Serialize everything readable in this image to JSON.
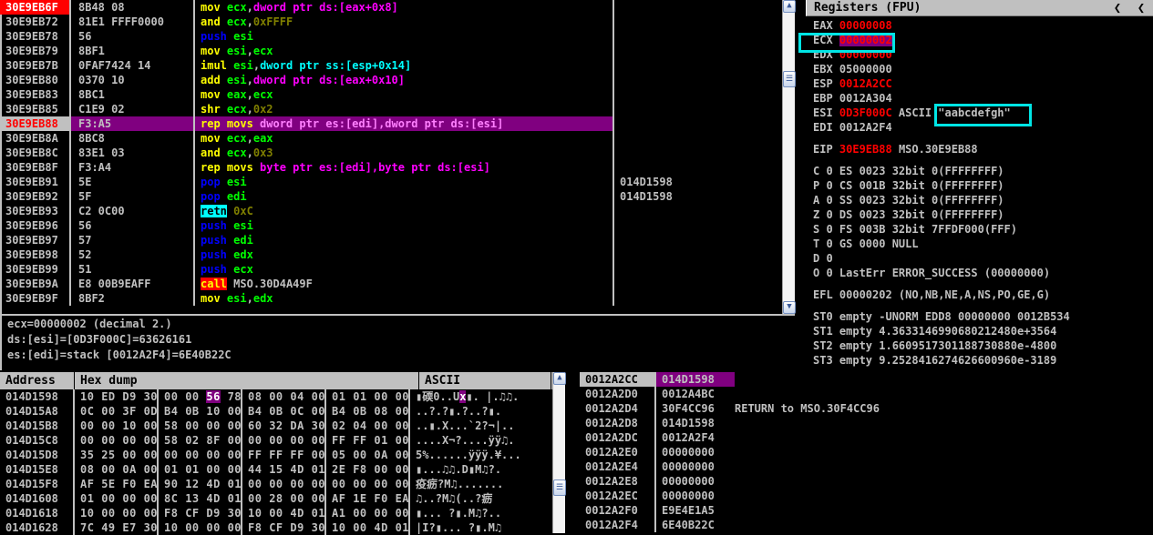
{
  "registers_panel": {
    "title": "Registers (FPU)",
    "nav_back_icon": "chevron-left-icon",
    "nav_back2_icon": "chevron-left-icon",
    "general": [
      {
        "name": "EAX",
        "value": "00000008",
        "value_color": "#ff0000",
        "extra": ""
      },
      {
        "name": "ECX",
        "value": "00000002",
        "value_color": "#ff0000",
        "extra": "",
        "highlighted": true
      },
      {
        "name": "EDX",
        "value": "00000000",
        "value_color": "#ff0000",
        "extra": ""
      },
      {
        "name": "EBX",
        "value": "05000000",
        "value_color": "#c0c0c0",
        "extra": ""
      },
      {
        "name": "ESP",
        "value": "0012A2CC",
        "value_color": "#ff0000",
        "extra": ""
      },
      {
        "name": "EBP",
        "value": "0012A304",
        "value_color": "#c0c0c0",
        "extra": ""
      },
      {
        "name": "ESI",
        "value": "0D3F000C",
        "value_color": "#ff0000",
        "extra": "ASCII",
        "ascii": "\"aabcdefgh\""
      },
      {
        "name": "EDI",
        "value": "0012A2F4",
        "value_color": "#c0c0c0",
        "extra": ""
      }
    ],
    "eip": {
      "name": "EIP",
      "value": "30E9EB88",
      "symbol": "MSO.30E9EB88"
    },
    "flags": [
      {
        "flag": "C",
        "val": "0",
        "seg": "ES",
        "sel": "0023",
        "mode": "32bit",
        "base": "0(FFFFFFFF)"
      },
      {
        "flag": "P",
        "val": "0",
        "seg": "CS",
        "sel": "001B",
        "mode": "32bit",
        "base": "0(FFFFFFFF)"
      },
      {
        "flag": "A",
        "val": "0",
        "seg": "SS",
        "sel": "0023",
        "mode": "32bit",
        "base": "0(FFFFFFFF)"
      },
      {
        "flag": "Z",
        "val": "0",
        "seg": "DS",
        "sel": "0023",
        "mode": "32bit",
        "base": "0(FFFFFFFF)"
      },
      {
        "flag": "S",
        "val": "0",
        "seg": "FS",
        "sel": "003B",
        "mode": "32bit",
        "base": "7FFDF000(FFF)"
      },
      {
        "flag": "T",
        "val": "0",
        "seg": "GS",
        "sel": "0000",
        "mode": "NULL",
        "base": ""
      },
      {
        "flag": "D",
        "val": "0",
        "seg": "",
        "sel": "",
        "mode": "",
        "base": ""
      },
      {
        "flag": "O",
        "val": "0",
        "seg": "",
        "sel": "",
        "mode": "",
        "base": "",
        "lasterr": "LastErr ERROR_SUCCESS (00000000)"
      }
    ],
    "efl": {
      "name": "EFL",
      "value": "00000202",
      "decoded": "(NO,NB,NE,A,NS,PO,GE,G)"
    },
    "fpu": [
      {
        "name": "ST0",
        "state": "empty",
        "value": "-UNORM EDD8 00000000 0012B534"
      },
      {
        "name": "ST1",
        "state": "empty",
        "value": "4.3633146990680212480e+3564"
      },
      {
        "name": "ST2",
        "state": "empty",
        "value": "1.6609517301188730880e-4800"
      },
      {
        "name": "ST3",
        "state": "empty",
        "value": "9.2528416274626600960e-3189"
      }
    ]
  },
  "disassembly": {
    "rows": [
      {
        "addr": "30E9EB6F",
        "bytes": "8B48 08",
        "text": [
          {
            "t": "mov",
            "c": "mn"
          },
          {
            "t": " ",
            "c": "plain"
          },
          {
            "t": "ecx",
            "c": "reg"
          },
          {
            "t": ",",
            "c": "plain"
          },
          {
            "t": "dword ptr ds:[eax+0x8]",
            "c": "memds"
          }
        ],
        "comment": "",
        "state": "eip"
      },
      {
        "addr": "30E9EB72",
        "bytes": "81E1 FFFF0000",
        "text": [
          {
            "t": "and",
            "c": "mn"
          },
          {
            "t": " ",
            "c": "plain"
          },
          {
            "t": "ecx",
            "c": "reg"
          },
          {
            "t": ",",
            "c": "plain"
          },
          {
            "t": "0xFFFF",
            "c": "num"
          }
        ],
        "comment": "",
        "state": ""
      },
      {
        "addr": "30E9EB78",
        "bytes": "56",
        "text": [
          {
            "t": "push",
            "c": "mn-push"
          },
          {
            "t": " ",
            "c": "plain"
          },
          {
            "t": "esi",
            "c": "reg"
          }
        ],
        "comment": "",
        "state": ""
      },
      {
        "addr": "30E9EB79",
        "bytes": "8BF1",
        "text": [
          {
            "t": "mov",
            "c": "mn"
          },
          {
            "t": " ",
            "c": "plain"
          },
          {
            "t": "esi",
            "c": "reg"
          },
          {
            "t": ",",
            "c": "plain"
          },
          {
            "t": "ecx",
            "c": "reg"
          }
        ],
        "comment": "",
        "state": ""
      },
      {
        "addr": "30E9EB7B",
        "bytes": "0FAF7424 14",
        "text": [
          {
            "t": "imul",
            "c": "mn"
          },
          {
            "t": " ",
            "c": "plain"
          },
          {
            "t": "esi",
            "c": "reg"
          },
          {
            "t": ",",
            "c": "plain"
          },
          {
            "t": "dword ptr ss:[esp+0x14]",
            "c": "memss"
          }
        ],
        "comment": "",
        "state": ""
      },
      {
        "addr": "30E9EB80",
        "bytes": "0370 10",
        "text": [
          {
            "t": "add",
            "c": "mn"
          },
          {
            "t": " ",
            "c": "plain"
          },
          {
            "t": "esi",
            "c": "reg"
          },
          {
            "t": ",",
            "c": "plain"
          },
          {
            "t": "dword ptr ds:[eax+0x10]",
            "c": "memds"
          }
        ],
        "comment": "",
        "state": ""
      },
      {
        "addr": "30E9EB83",
        "bytes": "8BC1",
        "text": [
          {
            "t": "mov",
            "c": "mn"
          },
          {
            "t": " ",
            "c": "plain"
          },
          {
            "t": "eax",
            "c": "reg"
          },
          {
            "t": ",",
            "c": "plain"
          },
          {
            "t": "ecx",
            "c": "reg"
          }
        ],
        "comment": "",
        "state": ""
      },
      {
        "addr": "30E9EB85",
        "bytes": "C1E9 02",
        "text": [
          {
            "t": "shr",
            "c": "mn"
          },
          {
            "t": " ",
            "c": "plain"
          },
          {
            "t": "ecx",
            "c": "reg"
          },
          {
            "t": ",",
            "c": "plain"
          },
          {
            "t": "0x2",
            "c": "num"
          }
        ],
        "comment": "",
        "state": ""
      },
      {
        "addr": "30E9EB88",
        "bytes": "F3:A5",
        "text": [
          {
            "t": "rep movs",
            "c": "mn"
          },
          {
            "t": " ",
            "c": "plain"
          },
          {
            "t": "dword ptr es:[edi],dword ptr ds:[esi]",
            "c": "op"
          }
        ],
        "comment": "",
        "state": "cur"
      },
      {
        "addr": "30E9EB8A",
        "bytes": "8BC8",
        "text": [
          {
            "t": "mov",
            "c": "mn"
          },
          {
            "t": " ",
            "c": "plain"
          },
          {
            "t": "ecx",
            "c": "reg"
          },
          {
            "t": ",",
            "c": "plain"
          },
          {
            "t": "eax",
            "c": "reg"
          }
        ],
        "comment": "",
        "state": ""
      },
      {
        "addr": "30E9EB8C",
        "bytes": "83E1 03",
        "text": [
          {
            "t": "and",
            "c": "mn"
          },
          {
            "t": " ",
            "c": "plain"
          },
          {
            "t": "ecx",
            "c": "reg"
          },
          {
            "t": ",",
            "c": "plain"
          },
          {
            "t": "0x3",
            "c": "num"
          }
        ],
        "comment": "",
        "state": ""
      },
      {
        "addr": "30E9EB8F",
        "bytes": "F3:A4",
        "text": [
          {
            "t": "rep movs",
            "c": "mn"
          },
          {
            "t": " ",
            "c": "plain"
          },
          {
            "t": "byte ptr es:[edi],byte ptr ds:[esi]",
            "c": "memds"
          }
        ],
        "comment": "",
        "state": ""
      },
      {
        "addr": "30E9EB91",
        "bytes": "5E",
        "text": [
          {
            "t": "pop",
            "c": "mn-pop"
          },
          {
            "t": " ",
            "c": "plain"
          },
          {
            "t": "esi",
            "c": "reg"
          }
        ],
        "comment": "014D1598",
        "state": ""
      },
      {
        "addr": "30E9EB92",
        "bytes": "5F",
        "text": [
          {
            "t": "pop",
            "c": "mn-pop"
          },
          {
            "t": " ",
            "c": "plain"
          },
          {
            "t": "edi",
            "c": "reg"
          }
        ],
        "comment": "014D1598",
        "state": ""
      },
      {
        "addr": "30E9EB93",
        "bytes": "C2 0C00",
        "text": [
          {
            "t": "retn",
            "c": "mn-retn"
          },
          {
            "t": " ",
            "c": "plain"
          },
          {
            "t": "0xC",
            "c": "num"
          }
        ],
        "comment": "",
        "state": ""
      },
      {
        "addr": "30E9EB96",
        "bytes": "56",
        "text": [
          {
            "t": "push",
            "c": "mn-push"
          },
          {
            "t": " ",
            "c": "plain"
          },
          {
            "t": "esi",
            "c": "reg"
          }
        ],
        "comment": "",
        "state": ""
      },
      {
        "addr": "30E9EB97",
        "bytes": "57",
        "text": [
          {
            "t": "push",
            "c": "mn-push"
          },
          {
            "t": " ",
            "c": "plain"
          },
          {
            "t": "edi",
            "c": "reg"
          }
        ],
        "comment": "",
        "state": ""
      },
      {
        "addr": "30E9EB98",
        "bytes": "52",
        "text": [
          {
            "t": "push",
            "c": "mn-push"
          },
          {
            "t": " ",
            "c": "plain"
          },
          {
            "t": "edx",
            "c": "reg"
          }
        ],
        "comment": "",
        "state": ""
      },
      {
        "addr": "30E9EB99",
        "bytes": "51",
        "text": [
          {
            "t": "push",
            "c": "mn-push"
          },
          {
            "t": " ",
            "c": "plain"
          },
          {
            "t": "ecx",
            "c": "reg"
          }
        ],
        "comment": "",
        "state": ""
      },
      {
        "addr": "30E9EB9A",
        "bytes": "E8 00B9EAFF",
        "text": [
          {
            "t": "call",
            "c": "mn-call"
          },
          {
            "t": " ",
            "c": "plain"
          },
          {
            "t": "MSO.30D4A49F",
            "c": "sym"
          }
        ],
        "comment": "",
        "state": ""
      },
      {
        "addr": "30E9EB9F",
        "bytes": "8BF2",
        "text": [
          {
            "t": "mov",
            "c": "mn"
          },
          {
            "t": " ",
            "c": "plain"
          },
          {
            "t": "esi",
            "c": "reg"
          },
          {
            "t": ",",
            "c": "plain"
          },
          {
            "t": "edx",
            "c": "reg"
          }
        ],
        "comment": "",
        "state": ""
      }
    ]
  },
  "info_bar": {
    "lines": [
      "ecx=00000002 (decimal 2.)",
      "ds:[esi]=[0D3F000C]=63626161",
      "es:[edi]=stack [0012A2F4]=6E40B22C"
    ]
  },
  "dump_panel": {
    "headers": [
      "Address",
      "Hex dump",
      "ASCII"
    ],
    "rows": [
      {
        "addr": "014D1598",
        "g": [
          "10 ED D9 30",
          "00 00 56 78",
          "08 00 04 00",
          "01 01 00 00"
        ],
        "ascii": "▮碝0..Ux▮. |.♫♫.",
        "hl": {
          "group": 1,
          "index": 2
        }
      },
      {
        "addr": "014D15A8",
        "g": [
          "0C 00 3F 0D",
          "B4 0B 10 00",
          "B4 0B 0C 00",
          "B4 0B 08 00"
        ],
        "ascii": "..?.?▮.?..?▮."
      },
      {
        "addr": "014D15B8",
        "g": [
          "00 00 10 00",
          "58 00 00 00",
          "60 32 DA 30",
          "02 04 00 00"
        ],
        "ascii": "..▮.X...`2?¬|.."
      },
      {
        "addr": "014D15C8",
        "g": [
          "00 00 00 00",
          "58 02 8F 00",
          "00 00 00 00",
          "FF FF 01 00"
        ],
        "ascii": "....X¬?....ÿÿ♫."
      },
      {
        "addr": "014D15D8",
        "g": [
          "35 25 00 00",
          "00 00 00 00",
          "FF FF FF 00",
          "05 00 0A 00"
        ],
        "ascii": "5%......ÿÿÿ.¥..."
      },
      {
        "addr": "014D15E8",
        "g": [
          "08 00 0A 00",
          "01 01 00 00",
          "44 15 4D 01",
          "2E F8 00 00"
        ],
        "ascii": "▮...♫♫.D▮M♫?."
      },
      {
        "addr": "014D15F8",
        "g": [
          "AF 5E F0 EA",
          "90 12 4D 01",
          "00 00 00 00",
          "00 00 00 00"
        ],
        "ascii": "疫疬?M♫......."
      },
      {
        "addr": "014D1608",
        "g": [
          "01 00 00 00",
          "8C 13 4D 01",
          "00 28 00 00",
          "AF 1E F0 EA"
        ],
        "ascii": "♫..?M♫(..?疬"
      },
      {
        "addr": "014D1618",
        "g": [
          "10 00 00 00",
          "F8 CF D9 30",
          "10 00 4D 01",
          "A1 00 00 00"
        ],
        "ascii": "▮...  ?▮.M♫?.."
      },
      {
        "addr": "014D1628",
        "g": [
          "7C 49 E7 30",
          "10 00 00 00",
          "F8 CF D9 30",
          "10 00 4D 01"
        ],
        "ascii": "|I?▮...  ?▮.M♫"
      }
    ]
  },
  "stack_panel": {
    "rows": [
      {
        "addr": "0012A2CC",
        "value": "014D1598",
        "comment": "",
        "selected": true
      },
      {
        "addr": "0012A2D0",
        "value": "0012A4BC",
        "comment": ""
      },
      {
        "addr": "0012A2D4",
        "value": "30F4CC96",
        "comment": "RETURN to MSO.30F4CC96"
      },
      {
        "addr": "0012A2D8",
        "value": "014D1598",
        "comment": ""
      },
      {
        "addr": "0012A2DC",
        "value": "0012A2F4",
        "comment": ""
      },
      {
        "addr": "0012A2E0",
        "value": "00000000",
        "comment": ""
      },
      {
        "addr": "0012A2E4",
        "value": "00000000",
        "comment": ""
      },
      {
        "addr": "0012A2E8",
        "value": "00000000",
        "comment": ""
      },
      {
        "addr": "0012A2EC",
        "value": "00000000",
        "comment": ""
      },
      {
        "addr": "0012A2F0",
        "value": "E9E4E1A5",
        "comment": ""
      },
      {
        "addr": "0012A2F4",
        "value": "6E40B22C",
        "comment": ""
      }
    ]
  },
  "colors": {
    "eip_highlight": "#ff0000",
    "current_line": "#800080",
    "selection_box": "#00e5e5",
    "mnemonic": "#ffff00",
    "register": "#00ff00",
    "memory": "#ff00ff",
    "background": "#000000",
    "chrome": "#c0c0c0"
  }
}
